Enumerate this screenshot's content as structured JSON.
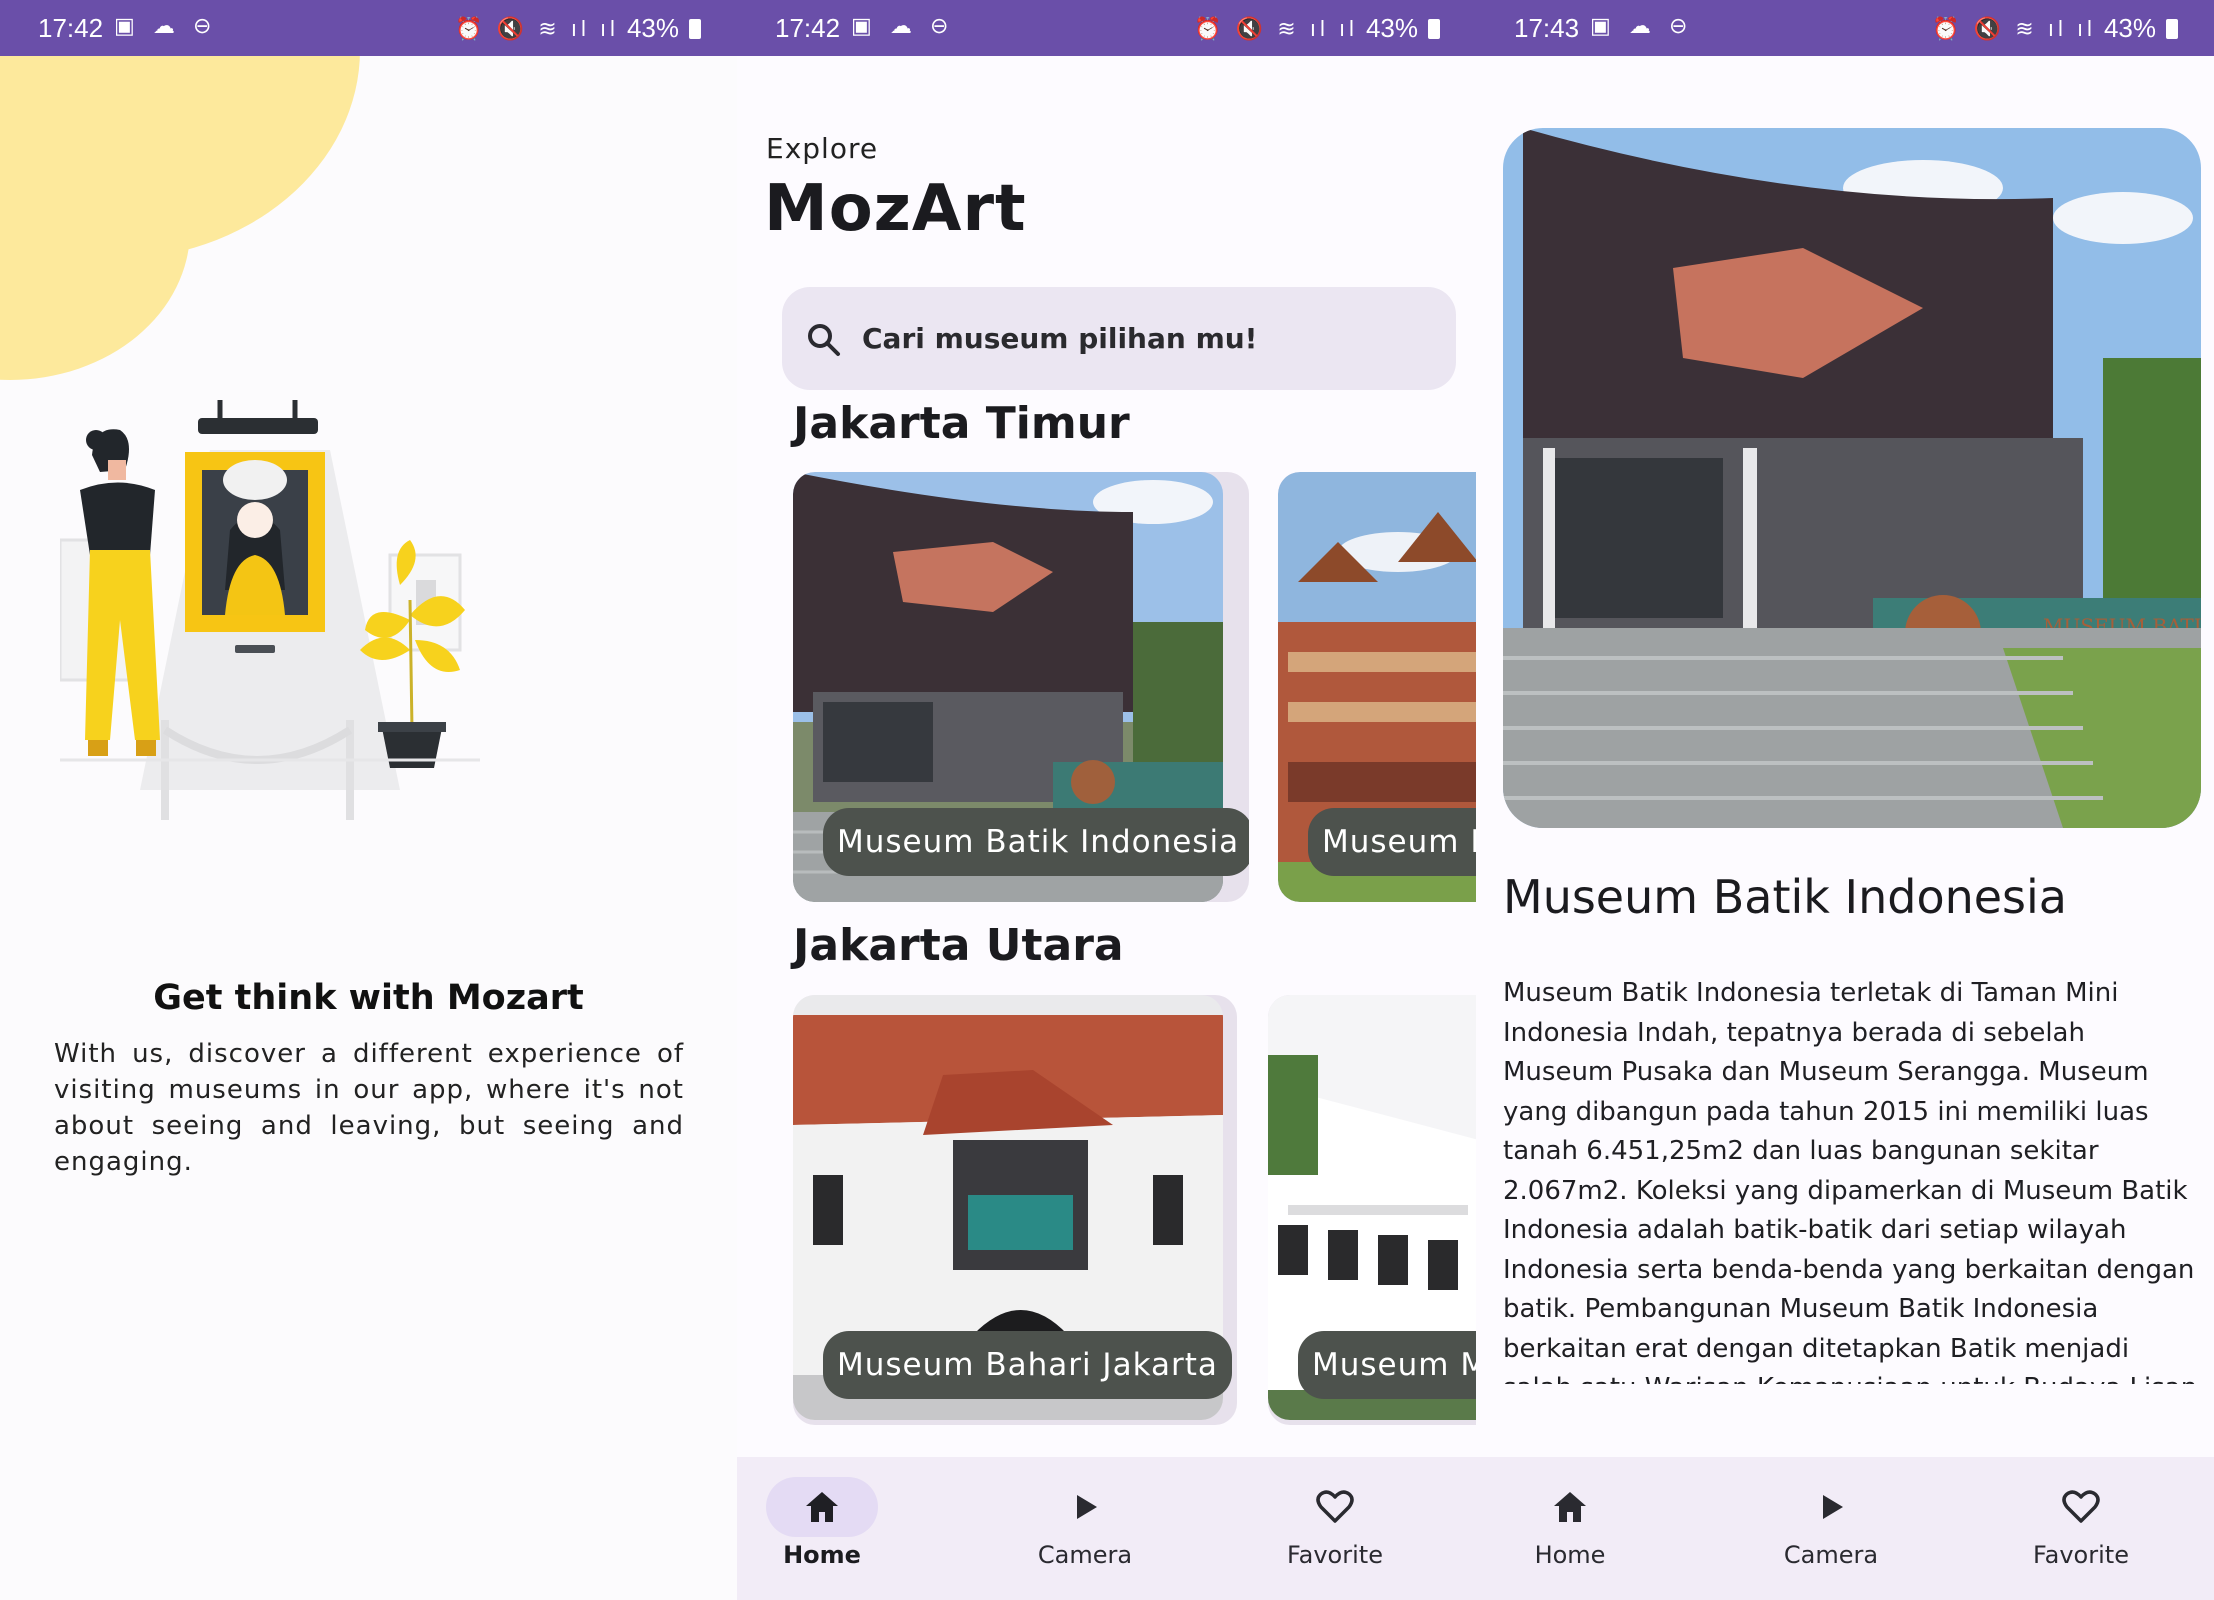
{
  "status_bars": [
    {
      "time": "17:42",
      "battery": "43%"
    },
    {
      "time": "17:42",
      "battery": "43%"
    },
    {
      "time": "17:43",
      "battery": "43%"
    }
  ],
  "onboarding": {
    "title": "Get think with Mozart",
    "description": "With us, discover a different experience of visiting museums in our app, where it's not about seeing and leaving, but seeing and engaging."
  },
  "home": {
    "subtitle": "Explore",
    "brand": "MozArt",
    "search_placeholder": "Cari museum pilihan mu!",
    "sections": [
      {
        "title": "Jakarta Timur",
        "cards": [
          "Museum Batik Indonesia",
          "Museum Ir"
        ]
      },
      {
        "title": "Jakarta Utara",
        "cards": [
          "Museum Bahari Jakarta",
          "Museum M"
        ]
      }
    ]
  },
  "detail": {
    "title": "Museum Batik Indonesia",
    "description": "Museum Batik Indonesia terletak di Taman Mini Indonesia Indah, tepatnya berada di sebelah Museum Pusaka dan Museum Serangga. Museum yang dibangun pada tahun 2015 ini memiliki luas tanah 6.451,25m2 dan luas bangunan sekitar 2.067m2. Koleksi yang dipamerkan di Museum Batik Indonesia adalah batik-batik dari setiap wilayah Indonesia serta benda-benda yang berkaitan dengan batik. Pembangunan Museum Batik Indonesia berkaitan erat dengan ditetapkan Batik menjadi salah satu Warisan Kemanusiaan untuk Budaya Lisan dan Nonbendawi",
    "photo_signage": "MUSEUM BATIK INDONESIA"
  },
  "nav": {
    "home": "Home",
    "camera": "Camera",
    "favorite": "Favorite",
    "active": "Home"
  },
  "colors": {
    "status_bar": "#6a4fa9",
    "accent_yellow": "#f7d21d",
    "nav_background": "#f2ecf7",
    "nav_active_pill": "#e4dbf4",
    "search_background": "#ebe6f2",
    "card_label": "#4d524d"
  },
  "icons": {
    "search": "search-icon",
    "home": "home-icon",
    "camera": "play-icon",
    "favorite": "heart-outline-icon"
  }
}
